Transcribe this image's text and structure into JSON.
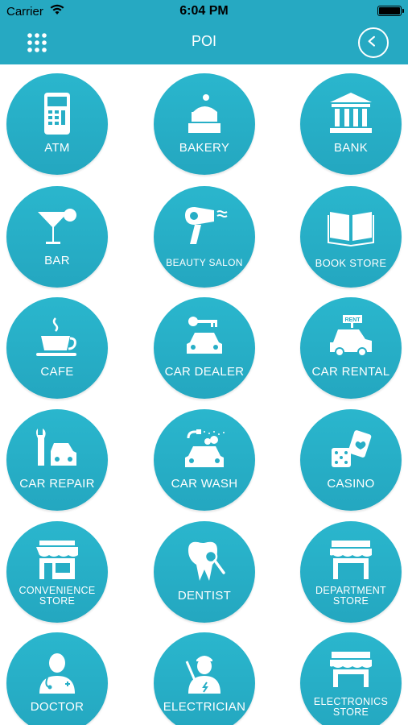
{
  "status": {
    "carrier": "Carrier",
    "time": "6:04 PM"
  },
  "nav": {
    "title": "POI",
    "menu_icon": "grid-menu-icon",
    "back_icon": "back-chevron-icon"
  },
  "colors": {
    "primary": "#26a9c2",
    "tile": "#2ab6cd",
    "background": "#ffffff"
  },
  "categories": [
    {
      "label": "ATM",
      "icon": "atm-icon"
    },
    {
      "label": "BAKERY",
      "icon": "cake-icon"
    },
    {
      "label": "BANK",
      "icon": "bank-icon"
    },
    {
      "label": "BAR",
      "icon": "cocktail-icon"
    },
    {
      "label": "BEAUTY SALON",
      "icon": "hair-dryer-icon"
    },
    {
      "label": "BOOK STORE",
      "icon": "open-book-icon"
    },
    {
      "label": "CAFE",
      "icon": "coffee-cup-icon"
    },
    {
      "label": "CAR DEALER",
      "icon": "car-key-icon"
    },
    {
      "label": "CAR RENTAL",
      "icon": "rent-car-icon"
    },
    {
      "label": "CAR REPAIR",
      "icon": "wrench-car-icon"
    },
    {
      "label": "CAR WASH",
      "icon": "car-wash-icon"
    },
    {
      "label": "CASINO",
      "icon": "dice-cards-icon"
    },
    {
      "label": "CONVENIENCE STORE",
      "line1": "CONVENIENCE",
      "line2": "STORE",
      "icon": "shop-icon"
    },
    {
      "label": "DENTIST",
      "icon": "tooth-icon"
    },
    {
      "label": "DEPARTMENT STORE",
      "line1": "DEPARTMENT",
      "line2": "STORE",
      "icon": "store-front-icon"
    },
    {
      "label": "DOCTOR",
      "icon": "doctor-icon"
    },
    {
      "label": "ELECTRICIAN",
      "icon": "electrician-icon"
    },
    {
      "label": "ELECTRONICS STORE",
      "line1": "ELECTRONICS",
      "line2": "STORE",
      "icon": "electronics-store-icon"
    }
  ]
}
